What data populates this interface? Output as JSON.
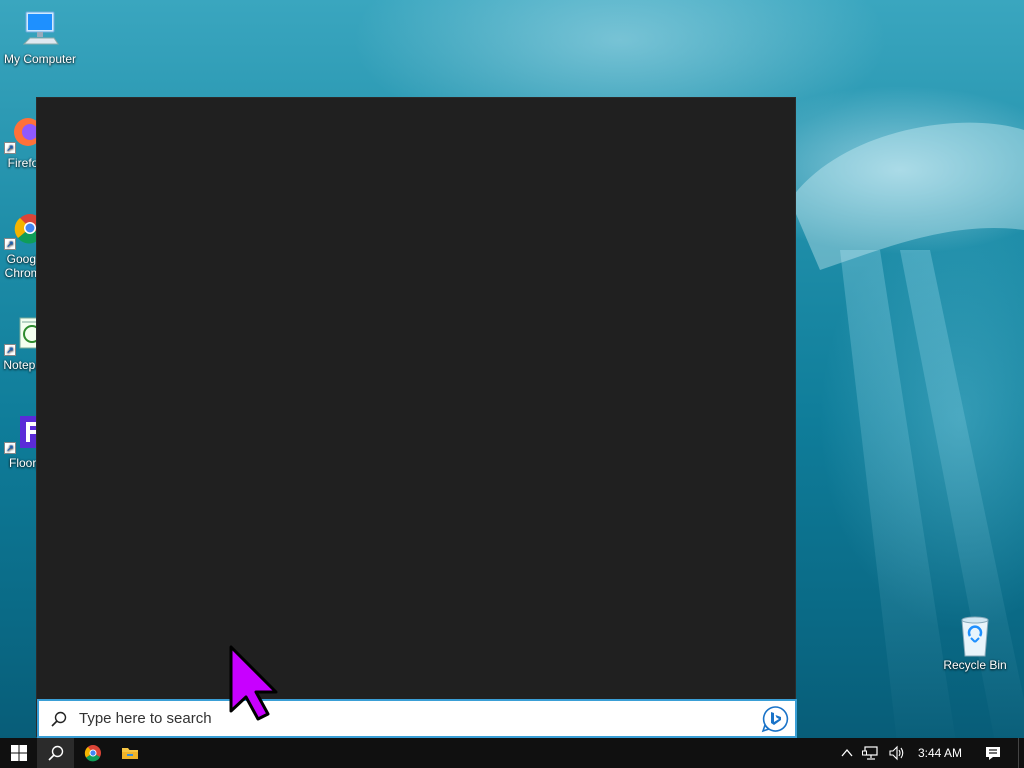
{
  "desktop": {
    "icons": [
      {
        "label": "My Computer",
        "icon": "computer-icon"
      },
      {
        "label": "Firefox",
        "icon": "firefox-icon"
      },
      {
        "label": "Google Chrome",
        "icon": "chrome-icon"
      },
      {
        "label": "Notepad",
        "icon": "notepad-icon"
      },
      {
        "label": "Floorp",
        "icon": "floorp-icon"
      },
      {
        "label": "Recycle Bin",
        "icon": "recycle-bin-icon"
      }
    ]
  },
  "search": {
    "placeholder": "Type here to search",
    "value": ""
  },
  "taskbar": {
    "start_icon": "windows-start-icon",
    "search_icon": "search-icon",
    "pinned": [
      "chrome-icon",
      "file-explorer-icon"
    ],
    "tray": [
      "chevron-up-icon",
      "network-icon",
      "volume-icon"
    ],
    "clock": "3:44 AM",
    "notifications_icon": "action-center-icon"
  },
  "colors": {
    "flyout_bg": "#202020",
    "taskbar_bg": "#101010",
    "search_border": "#3a9fd6",
    "cursor": "#c800ff"
  }
}
